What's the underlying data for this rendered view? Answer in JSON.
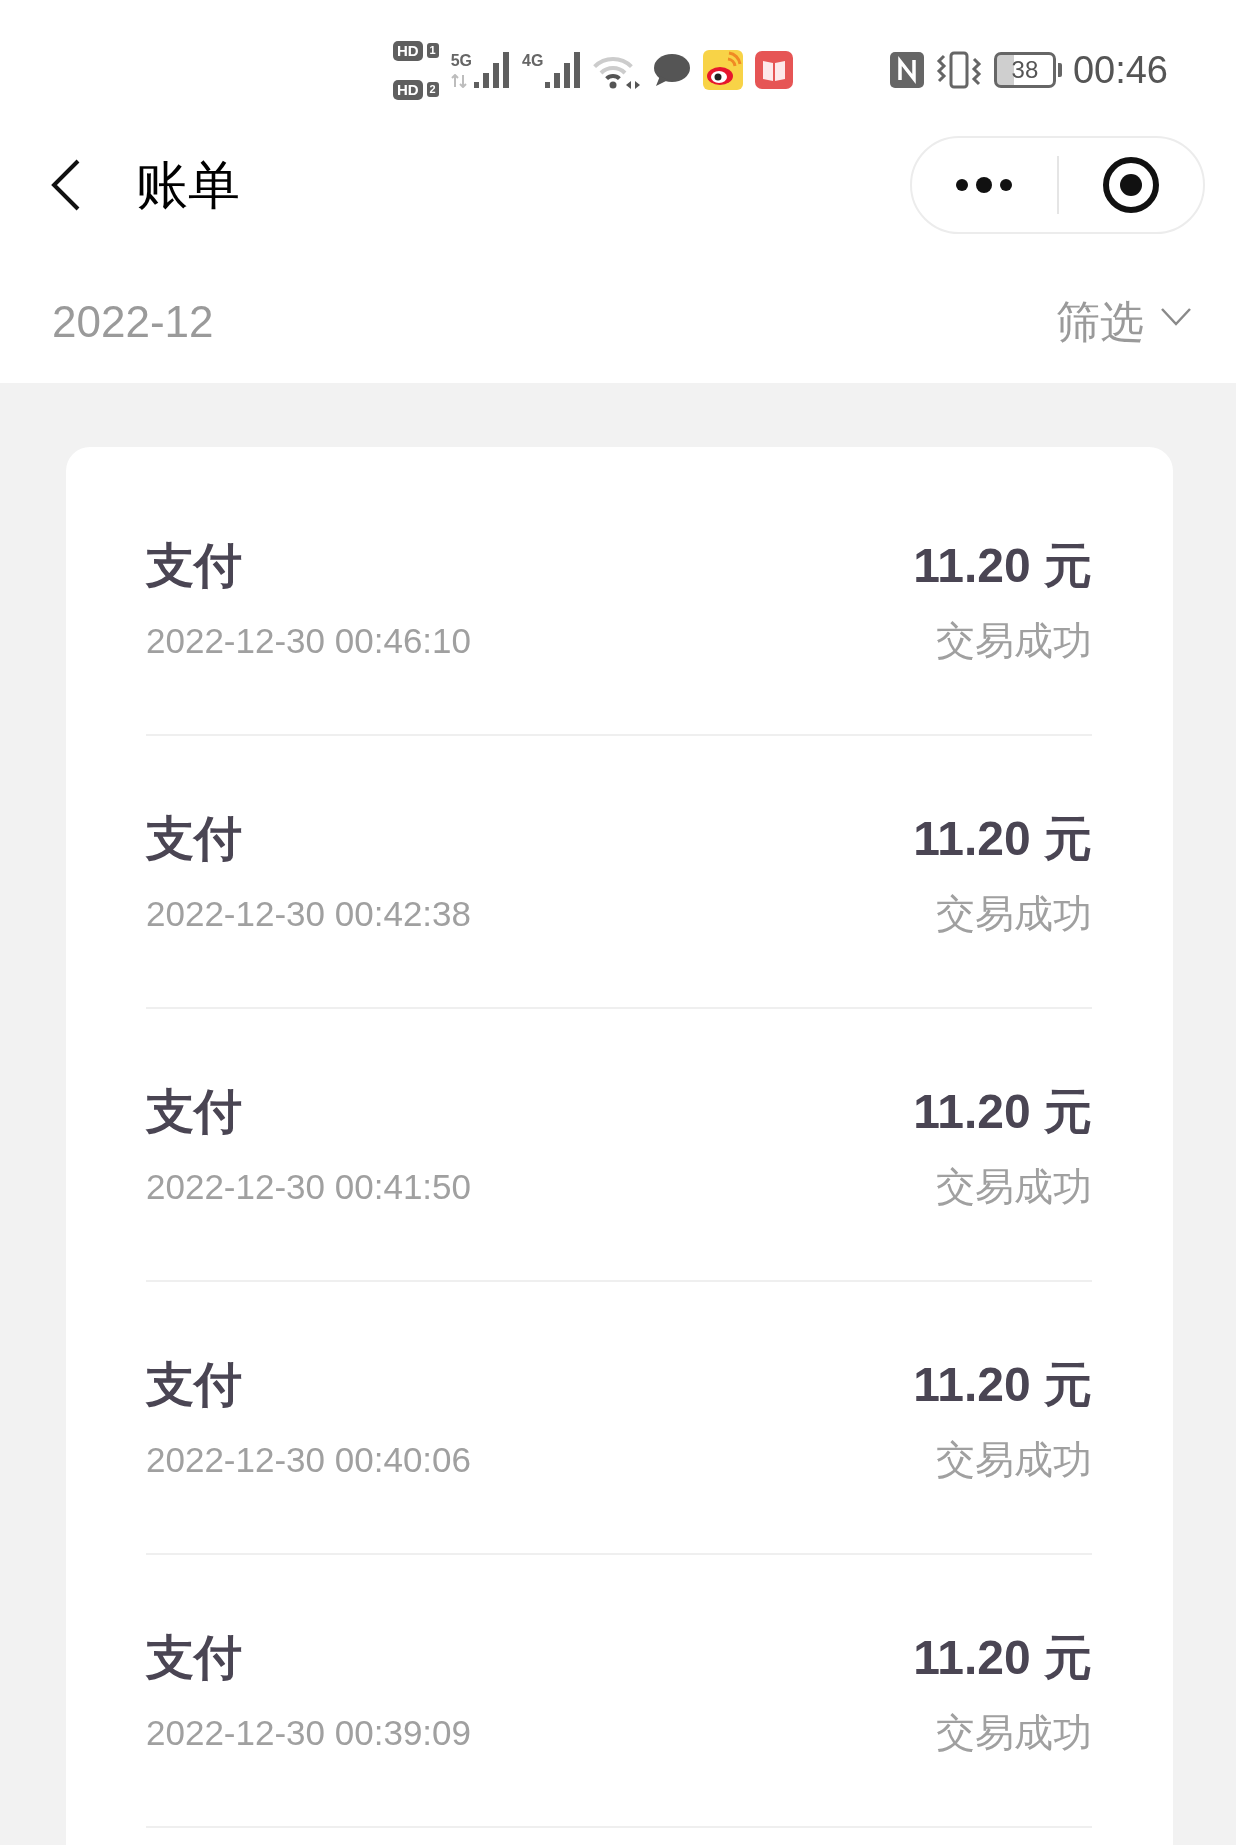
{
  "status_bar": {
    "hd_badges": [
      {
        "label": "HD",
        "slot": "1"
      },
      {
        "label": "HD",
        "slot": "2"
      }
    ],
    "signals": [
      {
        "network": "5G",
        "data_activity": true
      },
      {
        "network": "4G",
        "data_activity": false
      }
    ],
    "battery": "38",
    "time": "00:46"
  },
  "header": {
    "title": "账单"
  },
  "filter_bar": {
    "month": "2022-12",
    "filter_label": "筛选"
  },
  "transactions": [
    {
      "type": "支付",
      "time": "2022-12-30 00:46:10",
      "amount": "11.20 元",
      "status": "交易成功"
    },
    {
      "type": "支付",
      "time": "2022-12-30 00:42:38",
      "amount": "11.20 元",
      "status": "交易成功"
    },
    {
      "type": "支付",
      "time": "2022-12-30 00:41:50",
      "amount": "11.20 元",
      "status": "交易成功"
    },
    {
      "type": "支付",
      "time": "2022-12-30 00:40:06",
      "amount": "11.20 元",
      "status": "交易成功"
    },
    {
      "type": "支付",
      "time": "2022-12-30 00:39:09",
      "amount": "11.20 元",
      "status": "交易成功"
    }
  ]
}
